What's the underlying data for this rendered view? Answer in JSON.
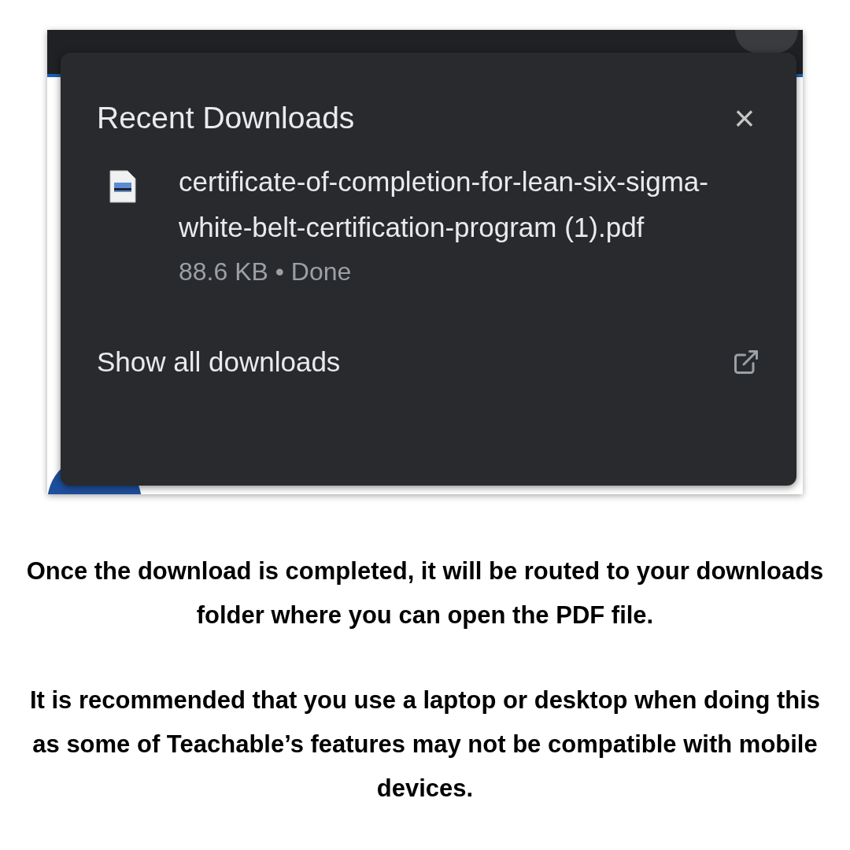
{
  "downloads_popup": {
    "title": "Recent Downloads",
    "close": "×",
    "items": [
      {
        "filename": "certificate-of-completion-for-lean-six-sigma-white-belt-certification-program (1).pdf",
        "size": "88.6 KB",
        "separator": "•",
        "status": "Done"
      }
    ],
    "show_all": "Show all downloads"
  },
  "caption": [
    "Once the download is completed, it will be routed to your downloads folder where you can open the PDF file.",
    "It is recommended that you use a laptop or desktop when doing this as some of Teachable’s features may not be compatible with mobile devices."
  ]
}
